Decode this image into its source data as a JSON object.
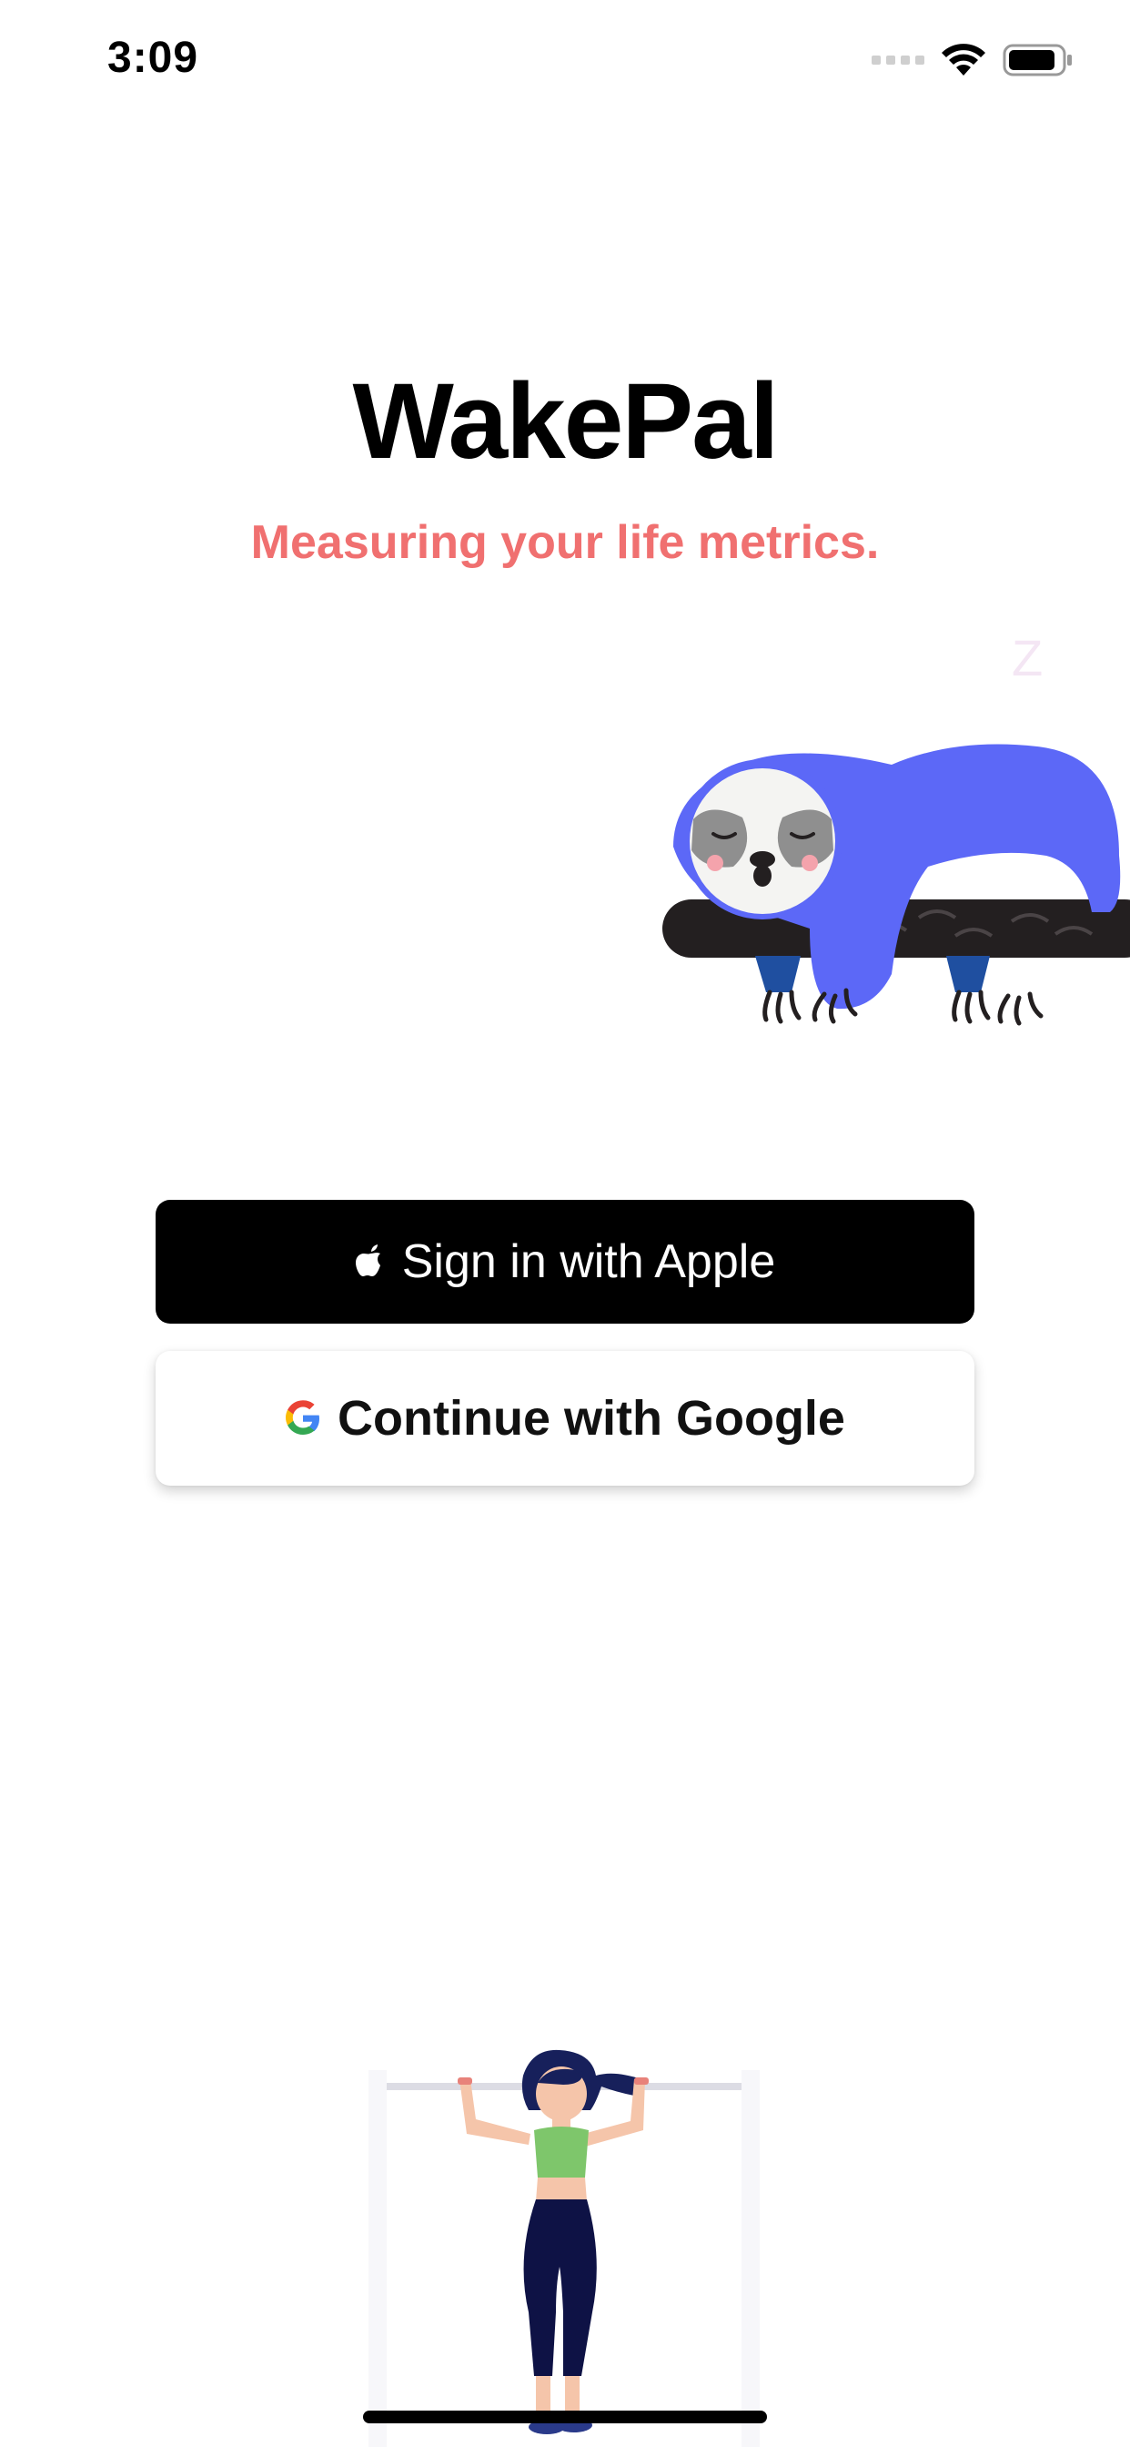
{
  "status_bar": {
    "time": "3:09",
    "icons": [
      "signal-icon",
      "wifi-icon",
      "battery-icon"
    ]
  },
  "app": {
    "title": "WakePal",
    "subtitle": "Measuring your life metrics.",
    "sleep_glyph": "Z"
  },
  "buttons": {
    "apple_label": "Sign in with Apple",
    "google_label": "Continue with Google"
  },
  "colors": {
    "subtitle": "#f07070",
    "sloth_body": "#5c68f7",
    "apple_button": "#000000",
    "google_button": "#ffffff"
  }
}
